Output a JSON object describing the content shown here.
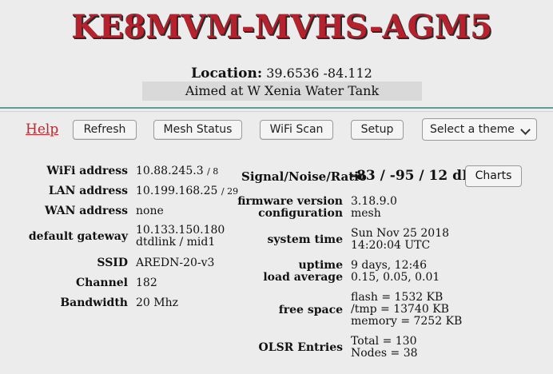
{
  "header": {
    "node_name": "KE8MVM-MVHS-AGM5",
    "location_label": "Location:",
    "location_value": "39.6536 -84.112",
    "description": "Aimed at W Xenia Water Tank"
  },
  "nav": {
    "help": "Help",
    "refresh": "Refresh",
    "mesh_status": "Mesh Status",
    "wifi_scan": "WiFi Scan",
    "setup": "Setup",
    "theme_selected": "Select a theme"
  },
  "left": {
    "wifi_label": "WiFi address",
    "wifi_ip": "10.88.245.3",
    "wifi_mask": "/ 8",
    "lan_label": "LAN address",
    "lan_ip": "10.199.168.25",
    "lan_mask": "/ 29",
    "wan_label": "WAN address",
    "wan_value": "none",
    "gw_label": "default gateway",
    "gw_ip": "10.133.150.180",
    "gw_name": "dtdlink / mid1",
    "ssid_label": "SSID",
    "ssid_value": "AREDN-20-v3",
    "channel_label": "Channel",
    "channel_value": "182",
    "bandwidth_label": "Bandwidth",
    "bandwidth_value": "20 Mhz"
  },
  "right": {
    "snr_label": "Signal/Noise/Ratio",
    "snr_value": "-83 / -95 / 12 dB",
    "charts": "Charts",
    "fw_label": "firmware version",
    "fw_value": "3.18.9.0",
    "config_label": "configuration",
    "config_value": "mesh",
    "systime_label": "system time",
    "systime_date": "Sun Nov 25 2018",
    "systime_time": "14:20:04 UTC",
    "uptime_label": "uptime",
    "uptime_value": "9 days, 12:46",
    "load_label": "load average",
    "load_value": "0.15, 0.05, 0.01",
    "free_label": "free space",
    "free_flash": "flash = 1532 KB",
    "free_tmp": "/tmp = 13740 KB",
    "free_mem": "memory = 7252 KB",
    "olsr_label": "OLSR Entries",
    "olsr_total": "Total = 130",
    "olsr_nodes": "Nodes = 38"
  }
}
